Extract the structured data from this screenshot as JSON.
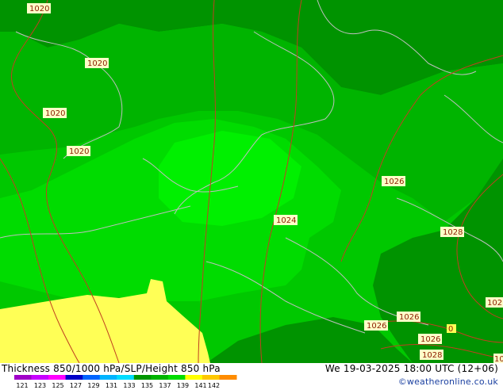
{
  "map": {
    "isobar_labels": [
      {
        "text": "1020",
        "pos": "top-left"
      },
      {
        "text": "1020",
        "pos": "upper-left"
      },
      {
        "text": "1020",
        "pos": "left"
      },
      {
        "text": "1020",
        "pos": "left-middle"
      },
      {
        "text": "1024",
        "pos": "center"
      },
      {
        "text": "1026",
        "pos": "right"
      },
      {
        "text": "1028",
        "pos": "right"
      },
      {
        "text": "102",
        "pos": "right-edge"
      },
      {
        "text": "1026",
        "pos": "bottom-right"
      },
      {
        "text": "1026",
        "pos": "bottom-right"
      },
      {
        "text": "1026",
        "pos": "bottom-right"
      },
      {
        "text": "1028",
        "pos": "bottom-right"
      },
      {
        "text": "10",
        "pos": "bottom-right-edge"
      },
      {
        "text": "0",
        "pos": "bottom-right"
      }
    ],
    "colors": {
      "dark_green": "#009300",
      "green": "#00b400",
      "mid_green": "#00c800",
      "light_green": "#00dc00",
      "bright_green": "#00f000",
      "yellow": "#ffff56",
      "isobar": "#c04020",
      "coast": "#bfbfbf"
    }
  },
  "footer": {
    "title": "Thickness 850/1000 hPa/SLP/Height 850 hPa",
    "valid": "We 19-03-2025 18:00 UTC (12+06)",
    "credit": "©weatheronline.co.uk",
    "scale_ticks": [
      "121",
      "123",
      "125",
      "127",
      "129",
      "131",
      "133",
      "135",
      "137",
      "139",
      "141",
      "142"
    ],
    "scale_colors": [
      "#a000c8",
      "#c800ff",
      "#ff00ff",
      "#0000c8",
      "#0064ff",
      "#00b4ff",
      "#00dcff",
      "#009600",
      "#00b400",
      "#00dc00",
      "#ffff00",
      "#ffc800",
      "#ff8c00"
    ]
  }
}
